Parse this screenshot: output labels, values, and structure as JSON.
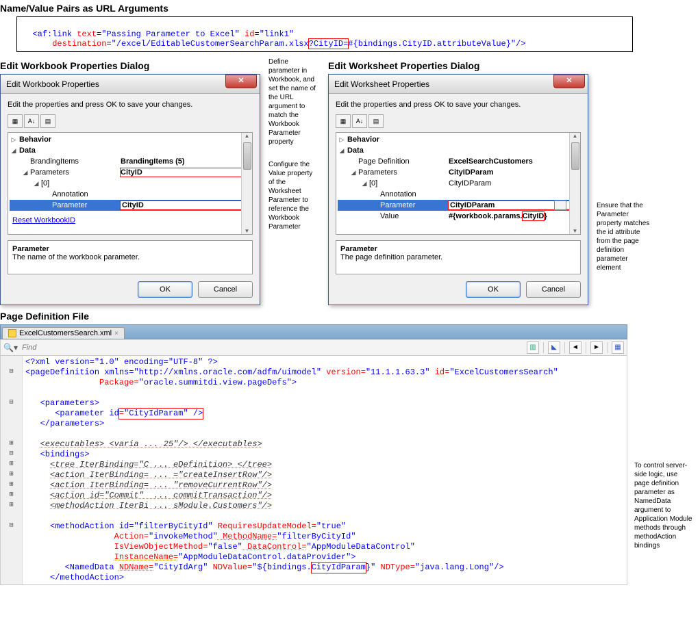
{
  "heading_url": "Name/Value Pairs as URL Arguments",
  "code_link": {
    "tag_open": "<af:link",
    "attr_text": "text",
    "val_text": "\"Passing Parameter to Excel\"",
    "attr_id": "id",
    "val_id": "\"link1\"",
    "attr_dest": "destination",
    "val_dest_pre": "\"/excel/EditableCustomerSearchParam.xlsx",
    "val_dest_hl": "?CityID=",
    "val_dest_post": "#{bindings.CityID.attributeValue}\"",
    "tag_close": "/>"
  },
  "heading_wb": "Edit Workbook Properties Dialog",
  "heading_ws": "Edit Worksheet Properties Dialog",
  "annot1": "Define parameter in Workbook, and set the name of the URL argument to match the Workbook Parameter property",
  "annot2": "Configure the Value property of the Worksheet Parameter to reference the Workbook Parameter",
  "annot3": "Ensure that the Parameter property matches the id attribute from the page definition parameter element",
  "annot4": "To control server-side logic, use page definition parameter as NamedData argument to Application Module methods through methodAction bindings",
  "wb": {
    "title": "Edit Workbook Properties",
    "instruction": "Edit the properties and press OK to save your changes.",
    "rows": {
      "behavior": "Behavior",
      "data": "Data",
      "brandingitems_l": "BrandingItems",
      "brandingitems_v": "BrandingItems (5)",
      "parameters_l": "Parameters",
      "parameters_v": "CityID",
      "zero": "[0]",
      "annotation": "Annotation",
      "parameter_l": "Parameter",
      "parameter_v": "CityID"
    },
    "reset": "Reset WorkbookID",
    "desc_t": "Parameter",
    "desc_b": "The name of the workbook parameter.",
    "ok": "OK",
    "cancel": "Cancel"
  },
  "ws": {
    "title": "Edit Worksheet Properties",
    "instruction": "Edit the properties and press OK to save your changes.",
    "rows": {
      "behavior": "Behavior",
      "data": "Data",
      "pagedef_l": "Page Definition",
      "pagedef_v": "ExcelSearchCustomers",
      "parameters_l": "Parameters",
      "parameters_v": "CityIDParam",
      "zero": "[0]",
      "zero_v": "CityIDParam",
      "annotation": "Annotation",
      "parameter_l": "Parameter",
      "parameter_v": "CityIDParam",
      "value_l": "Value",
      "value_v_pre": "#{workbook.params.",
      "value_v_hl": "CityID",
      "value_v_post": "}"
    },
    "desc_t": "Parameter",
    "desc_b": "The page definition parameter.",
    "ok": "OK",
    "cancel": "Cancel"
  },
  "heading_pd": "Page Definition File",
  "file_tab": "ExcelCustomersSearch.xml",
  "find_placeholder": "Find",
  "xml": {
    "l1": "<?xml version=\"1.0\" encoding=\"UTF-8\" ?>",
    "l2a": "<pageDefinition xmlns=",
    "l2b": "\"http://xmlns.oracle.com/adfm/uimodel\"",
    "l2c": " version=",
    "l2d": "\"11.1.1.63.3\"",
    "l2e": " id=",
    "l2f": "\"ExcelCustomersSearch\"",
    "l3a": "Package=",
    "l3b": "\"oracle.summitdi.view.pageDefs\"",
    "l3c": ">",
    "l4": "<parameters>",
    "l5a": "<parameter id",
    "l5b": "=\"CityIdParam\" />",
    "l6": "</parameters>",
    "l7": "<executables> <varia ... 25\"/> </executables>",
    "l8": "<bindings>",
    "l9": "<tree IterBinding=\"C ... eDefinition> </tree>",
    "l10": "<action IterBinding= ... =\"createInsertRow\"/>",
    "l11": "<action IterBinding= ... \"removeCurrentRow\"/>",
    "l12": "<action id=\"Commit\"  ... commitTransaction\"/>",
    "l13": "<methodAction IterBi ... sModule.Customers\"/>",
    "l14a": "<methodAction id=",
    "l14b": "\"filterByCityId\"",
    "l14c": " RequiresUpdateModel=",
    "l14d": "\"true\"",
    "l15a": "Action=",
    "l15b": "\"invokeMethod\"",
    "l15c": " MethodName=",
    "l15d": "\"filterByCityId\"",
    "l16a": "IsViewObjectMethod=",
    "l16b": "\"false\"",
    "l16c": " DataControl=",
    "l16d": "\"AppModuleDataControl\"",
    "l17a": "InstanceName=",
    "l17b": "\"AppModuleDataControl.dataProvider\"",
    "l17c": ">",
    "l18a": "<NamedData NDName=",
    "l18b": "\"CityIdArg\"",
    "l18c": " NDValue=",
    "l18d": "\"${bindings.",
    "l18e": "CityIdParam",
    "l18f": "}\"",
    "l18g": " NDType=",
    "l18h": "\"java.lang.Long\"",
    "l18i": "/>",
    "l19": "</methodAction>"
  }
}
